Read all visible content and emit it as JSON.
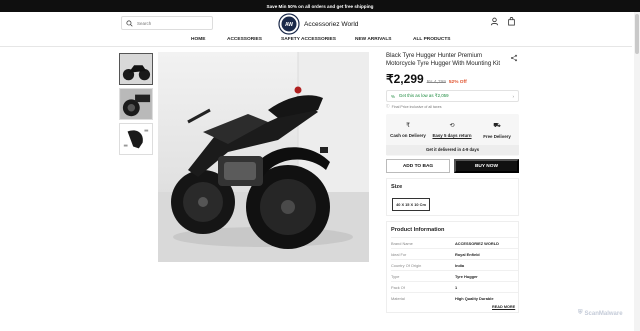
{
  "announcement": "Save Min 50% on all orders and get free shipping",
  "header": {
    "search_placeholder": "Search",
    "brand": "Accessoriez World",
    "logo_mark": "AW"
  },
  "nav": [
    "HOME",
    "ACCESSORIES",
    "SAFETY ACCESSORIES",
    "NEW ARRIVALS",
    "ALL PRODUCTS"
  ],
  "product": {
    "title": "Black Tyre Hugger Hunter Premium Motorcycle Tyre Hugger With Mounting Kit",
    "price": "₹2,299",
    "mrp": "Rs.4,799",
    "discount": "52% Off",
    "offer": "Get this as low as ₹2,059",
    "tax_note": "Final Price inclusive of all taxes",
    "features": [
      {
        "icon": "₹",
        "label": "Cash on Delivery"
      },
      {
        "icon": "⟲",
        "label": "Easy 5 days return"
      },
      {
        "icon": "⛟",
        "label": "Free Delivery"
      }
    ],
    "delivery": "Get it delivered in 4-9 days",
    "add_to_bag": "ADD TO BAG",
    "buy_now": "BUY NOW",
    "size_title": "Size",
    "size_option": "40 X 15 X 10 Cm",
    "info_title": "Product Information",
    "info": [
      {
        "k": "Brand Name",
        "v": "ACCESSORIEZ WORLD"
      },
      {
        "k": "Ideal For",
        "v": "Royal Enfield"
      },
      {
        "k": "Country Of Origin",
        "v": "India"
      },
      {
        "k": "Type",
        "v": "Tyre Hugger"
      },
      {
        "k": "Pack Of",
        "v": "1"
      },
      {
        "k": "Material",
        "v": "High Quality Durable"
      }
    ],
    "read_more": "READ MORE"
  },
  "watermark": "ScanMalware"
}
